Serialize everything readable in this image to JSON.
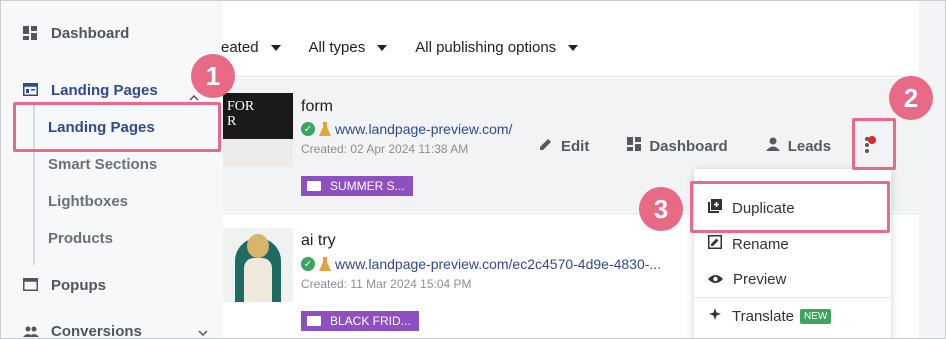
{
  "sidebar": {
    "dashboard": "Dashboard",
    "landing_pages_header": "Landing Pages",
    "sub_items": [
      "Landing Pages",
      "Smart Sections",
      "Lightboxes",
      "Products"
    ],
    "popups": "Popups",
    "conversions": "Conversions"
  },
  "filters": {
    "created": "eated",
    "types": "All types",
    "publishing": "All publishing options"
  },
  "rows": [
    {
      "title": "form",
      "url": "www.landpage-preview.com/",
      "created": "Created: 02 Apr 2024 11:38 AM",
      "tag": "SUMMER S...",
      "thumb_text": "FOR\nR"
    },
    {
      "title": "ai try",
      "url": "www.landpage-preview.com/ec2c4570-4d9e-4830-...",
      "created": "Created: 11 Mar 2024 15:04 PM",
      "tag": "BLACK FRID..."
    }
  ],
  "actions": {
    "edit": "Edit",
    "dashboard": "Dashboard",
    "leads": "Leads"
  },
  "menu": {
    "duplicate": "Duplicate",
    "rename": "Rename",
    "preview": "Preview",
    "translate": "Translate",
    "new_badge": "NEW"
  },
  "annotations": [
    "1",
    "2",
    "3"
  ],
  "colors": {
    "accent": "#2f4a8f",
    "highlight": "#e86a86",
    "tag": "#8e4fc1",
    "success": "#3aa55c"
  }
}
